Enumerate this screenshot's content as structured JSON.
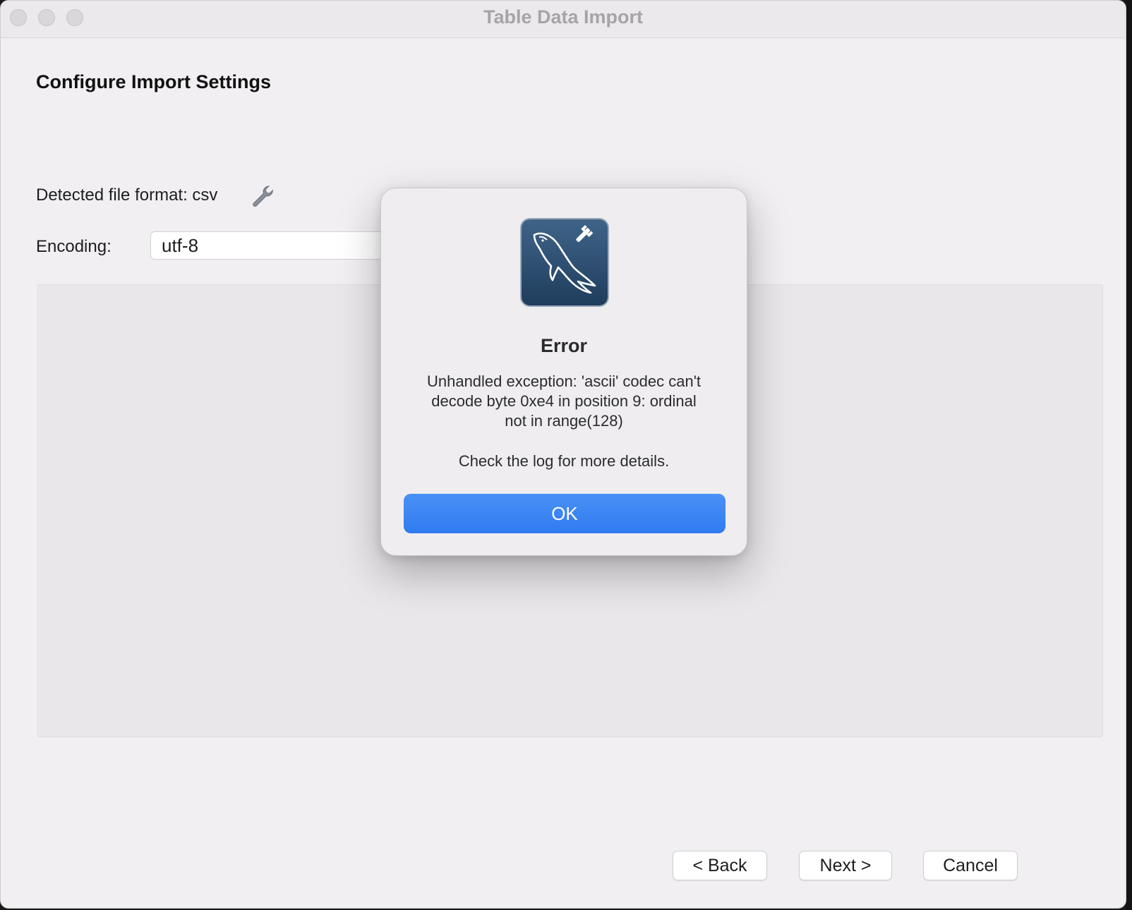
{
  "window": {
    "title": "Table Data Import"
  },
  "page": {
    "heading": "Configure Import Settings",
    "detected_format_label": "Detected file format: csv",
    "encoding_label": "Encoding:",
    "encoding_value": "utf-8"
  },
  "footer": {
    "back_label": "< Back",
    "next_label": "Next >",
    "cancel_label": "Cancel"
  },
  "dialog": {
    "title": "Error",
    "message_line1": "Unhandled exception: 'ascii' codec can't",
    "message_line2": "decode byte 0xe4 in position 9: ordinal",
    "message_line3": "not in range(128)",
    "detail": "Check the log for more details.",
    "ok_label": "OK"
  },
  "colors": {
    "accent": "#2f7bf0",
    "app_icon": "#2a4a6c",
    "window_bg": "#f1eff2"
  },
  "icons": {
    "settings": "wrench-icon",
    "app": "mysql-workbench-dolphin-icon"
  }
}
